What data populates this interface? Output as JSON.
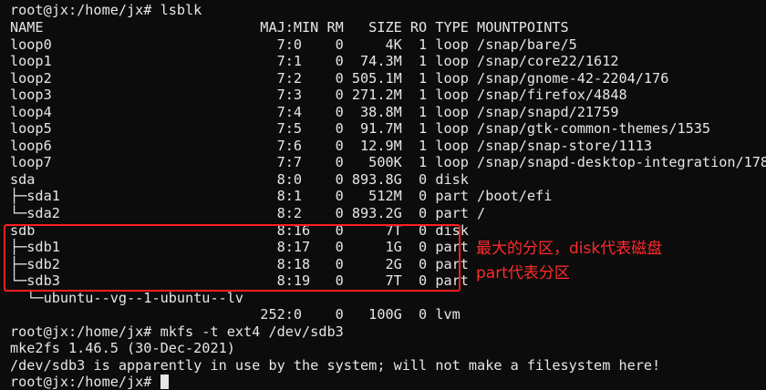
{
  "terminal": {
    "lines": [
      "root@jx:/home/jx# lsblk",
      "NAME                          MAJ:MIN RM   SIZE RO TYPE MOUNTPOINTS",
      "loop0                           7:0    0     4K  1 loop /snap/bare/5",
      "loop1                           7:1    0  74.3M  1 loop /snap/core22/1612",
      "loop2                           7:2    0 505.1M  1 loop /snap/gnome-42-2204/176",
      "loop3                           7:3    0 271.2M  1 loop /snap/firefox/4848",
      "loop4                           7:4    0  38.8M  1 loop /snap/snapd/21759",
      "loop5                           7:5    0  91.7M  1 loop /snap/gtk-common-themes/1535",
      "loop6                           7:6    0  12.9M  1 loop /snap/snap-store/1113",
      "loop7                           7:7    0   500K  1 loop /snap/snapd-desktop-integration/178",
      "sda                             8:0    0 893.8G  0 disk",
      "├─sda1                          8:1    0   512M  0 part /boot/efi",
      "└─sda2                          8:2    0 893.2G  0 part /",
      "sdb                             8:16   0     7T  0 disk",
      "├─sdb1                          8:17   0     1G  0 part",
      "├─sdb2                          8:18   0     2G  0 part",
      "└─sdb3                          8:19   0     7T  0 part",
      "  └─ubuntu--vg--1-ubuntu--lv",
      "                              252:0    0   100G  0 lvm",
      "root@jx:/home/jx# mkfs -t ext4 /dev/sdb3",
      "mke2fs 1.46.5 (30-Dec-2021)",
      "/dev/sdb3 is apparently in use by the system; will not make a filesystem here!",
      "root@jx:/home/jx# "
    ]
  },
  "annotation": {
    "line1": "最大的分区，disk代表磁盘",
    "line2": "part代表分区",
    "color": "#ff2a2a"
  },
  "colors": {
    "background": "#0c0c0c",
    "text": "#e6e6e6",
    "highlight_border": "#ff1f1f"
  }
}
